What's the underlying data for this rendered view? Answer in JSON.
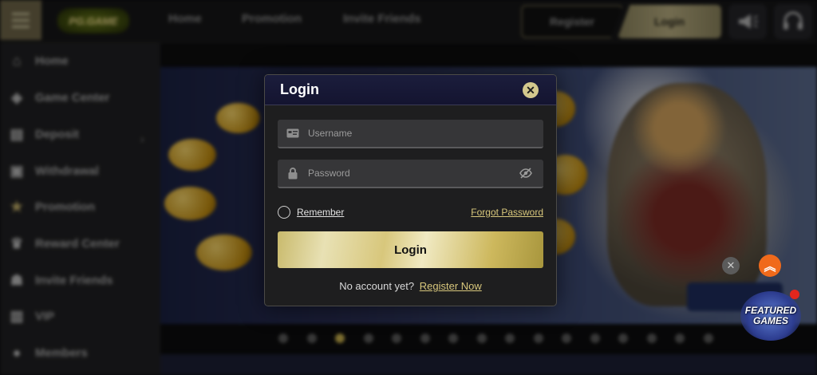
{
  "header": {
    "logo_text": "PG.GAME",
    "nav": [
      "Home",
      "Promotion",
      "Invite Friends"
    ],
    "register_label": "Register",
    "login_label": "Login"
  },
  "sidebar": {
    "items": [
      {
        "label": "Home",
        "icon": "home-icon"
      },
      {
        "label": "Game Center",
        "icon": "diamond-icon"
      },
      {
        "label": "Deposit",
        "icon": "deposit-icon"
      },
      {
        "label": "Withdrawal",
        "icon": "withdrawal-icon"
      },
      {
        "label": "Promotion",
        "icon": "star-icon"
      },
      {
        "label": "Reward Center",
        "icon": "trophy-icon"
      },
      {
        "label": "Invite Friends",
        "icon": "invite-icon"
      },
      {
        "label": "VIP",
        "icon": "vip-icon"
      },
      {
        "label": "Members",
        "icon": "members-icon"
      }
    ]
  },
  "hero": {
    "slide_count": 16,
    "active_slide": 3
  },
  "floating": {
    "featured_line1": "FEATURED",
    "featured_line2": "GAMES"
  },
  "modal": {
    "title": "Login",
    "username_placeholder": "Username",
    "password_placeholder": "Password",
    "remember_label": "Remember",
    "forgot_label": "Forgot Password",
    "submit_label": "Login",
    "no_account_text": "No account yet?",
    "register_link": "Register Now"
  },
  "colors": {
    "accent_gold": "#d8c77c",
    "modal_header": "#1b1d3c",
    "scroll_top_orange": "#f06a1b"
  }
}
